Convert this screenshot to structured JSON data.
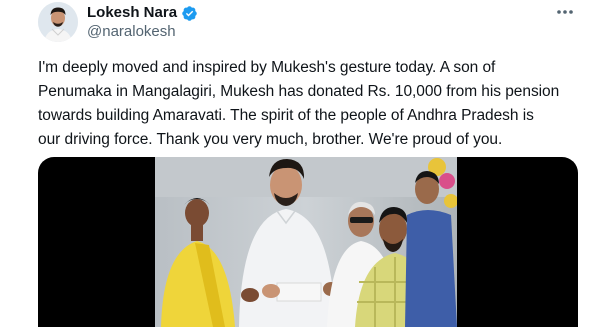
{
  "author": {
    "display_name": "Lokesh Nara",
    "handle": "@naralokesh",
    "verified_color": "#1d9bf0"
  },
  "tweet": {
    "text": "I'm deeply moved and inspired by Mukesh's gesture today. A son of\nPenumaka in Mangalagiri, Mukesh has donated Rs. 10,000 from his pension\ntowards building Amaravati. The spirit of the people of Andhra Pradesh is\nour driving force. Thank you very much, brother. We're proud of you."
  },
  "icons": {
    "verified": "verified-badge-icon",
    "more": "more-options-icon"
  },
  "media": {
    "background": "#000000"
  }
}
